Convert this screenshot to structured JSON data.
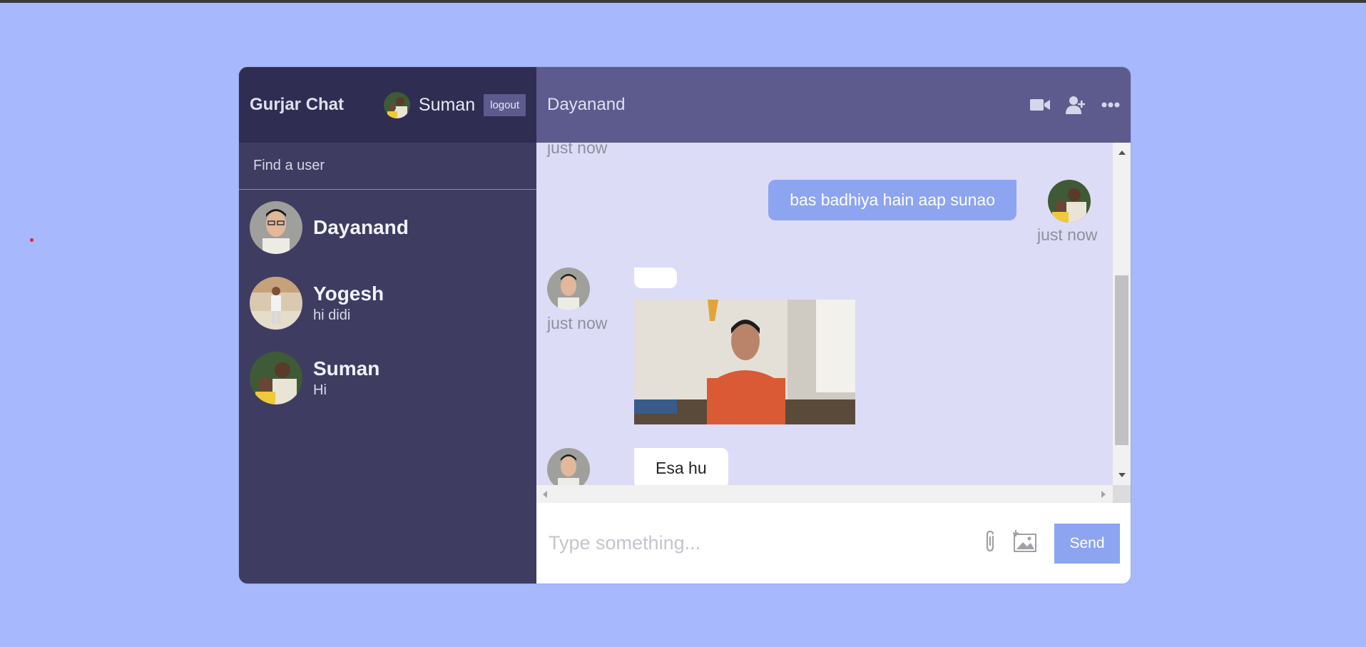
{
  "app": {
    "brand": "Gurjar Chat"
  },
  "current_user": {
    "name": "Suman",
    "logout_label": "logout"
  },
  "search": {
    "placeholder": "Find a user"
  },
  "chats": [
    {
      "name": "Dayanand",
      "last_message": ""
    },
    {
      "name": "Yogesh",
      "last_message": "hi didi"
    },
    {
      "name": "Suman",
      "last_message": "Hi"
    }
  ],
  "conversation": {
    "title": "Dayanand",
    "messages": [
      {
        "from": "other",
        "text": "",
        "time": "just now"
      },
      {
        "from": "owner",
        "text": "bas badhiya hain aap sunao",
        "time": "just now"
      },
      {
        "from": "other",
        "text": "",
        "image": "photo of man in orange polo shirt",
        "time": "just now"
      },
      {
        "from": "other",
        "text": "Esa hu",
        "time": ""
      }
    ]
  },
  "composer": {
    "placeholder": "Type something...",
    "send_label": "Send"
  },
  "icons": {
    "video": "video-camera-icon",
    "add_user": "add-user-icon",
    "more": "more-dots-icon",
    "attach": "paperclip-icon",
    "image": "add-image-icon"
  },
  "colors": {
    "background": "#a7b8fd",
    "sidebar": "#3e3c61",
    "navbar": "#2f2d52",
    "chat_header": "#5d5b8d",
    "chat_bg": "#dddcf7",
    "owner_bubble": "#8da4f1"
  }
}
